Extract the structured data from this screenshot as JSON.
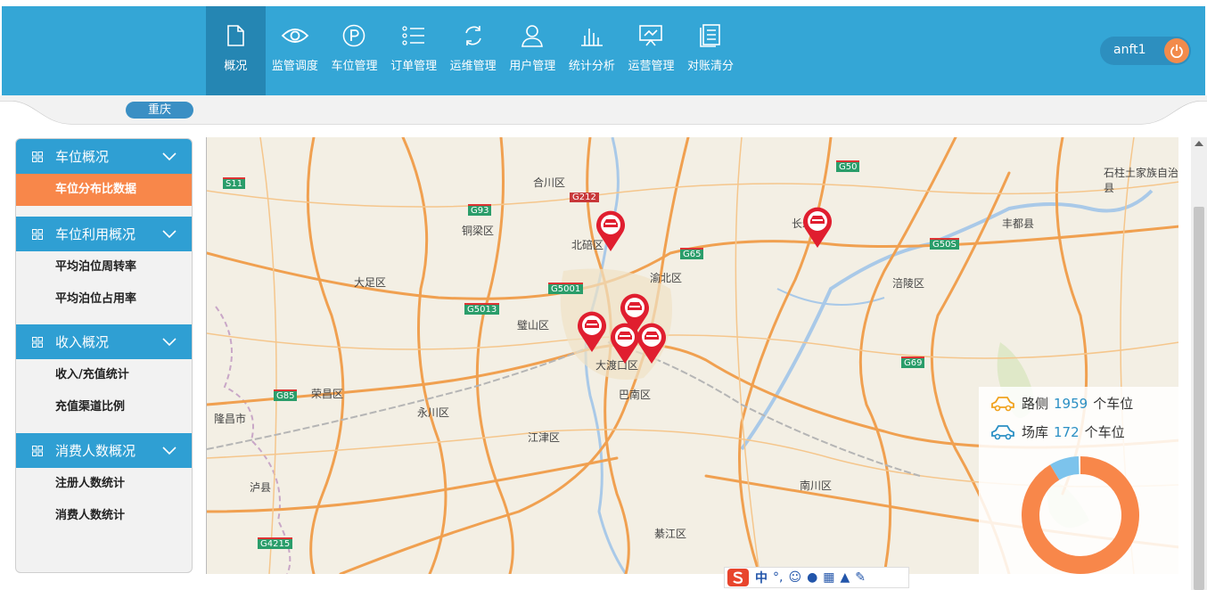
{
  "nav": {
    "items": [
      {
        "label": "概况",
        "icon": "document-icon"
      },
      {
        "label": "监管调度",
        "icon": "eye-icon"
      },
      {
        "label": "车位管理",
        "icon": "parking-icon"
      },
      {
        "label": "订单管理",
        "icon": "list-icon"
      },
      {
        "label": "运维管理",
        "icon": "refresh-icon"
      },
      {
        "label": "用户管理",
        "icon": "user-icon"
      },
      {
        "label": "统计分析",
        "icon": "bar-chart-icon"
      },
      {
        "label": "运营管理",
        "icon": "presentation-icon"
      },
      {
        "label": "对账清分",
        "icon": "ledger-icon"
      }
    ],
    "active": "概况"
  },
  "user": {
    "name": "anft1"
  },
  "city": "重庆",
  "sidebar": {
    "sections": [
      {
        "title": "车位概况",
        "items": [
          "车位分布比数据"
        ]
      },
      {
        "title": "车位利用概况",
        "items": [
          "平均泊位周转率",
          "平均泊位占用率"
        ]
      },
      {
        "title": "收入概况",
        "items": [
          "收入/充值统计",
          "充值渠道比例"
        ]
      },
      {
        "title": "消费人数概况",
        "items": [
          "注册人数统计",
          "消费人数统计"
        ]
      }
    ],
    "active_item": "车位分布比数据"
  },
  "map": {
    "place_labels": [
      "合川区",
      "铜梁区",
      "北碚区",
      "渝北区",
      "大足区",
      "璧山区",
      "大渡口区",
      "巴南区",
      "荣昌区",
      "永川区",
      "江津区",
      "南川区",
      "綦江区",
      "隆昌市",
      "泸县",
      "涪陵区",
      "丰都县",
      "长寿区",
      "石柱土家族自治县"
    ],
    "road_labels": [
      "S11",
      "G212",
      "G93",
      "G65",
      "G50",
      "G50S",
      "G5001",
      "G5013",
      "G85",
      "G69",
      "G4215"
    ],
    "marker_icon": "parking-pin-icon"
  },
  "legend": {
    "roadside": {
      "prefix": "路侧",
      "count": "1959",
      "suffix": "个车位",
      "icon": "car-icon",
      "color": "#f0a21f"
    },
    "garage": {
      "prefix": "场库",
      "count": "172",
      "suffix": "个车位",
      "icon": "car-icon",
      "color": "#2a8fc4"
    }
  },
  "donut": {
    "roadside_share": 0.919,
    "garage_share": 0.081,
    "roadside_color": "#f8874a",
    "garage_color": "#7cc3ec"
  },
  "ime": {
    "label": "中"
  }
}
